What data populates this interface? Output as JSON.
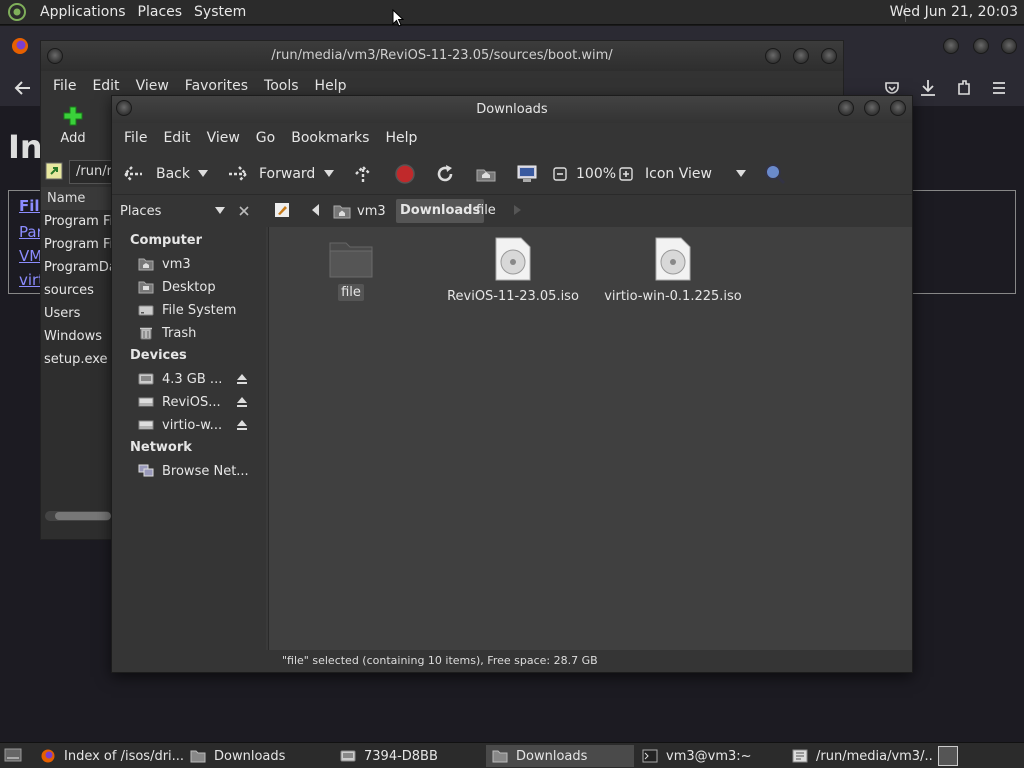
{
  "top_panel": {
    "menus": [
      "Applications",
      "Places",
      "System"
    ],
    "clock": "Wed Jun 21, 20:03"
  },
  "firefox": {
    "heading": "Ind",
    "links": [
      "File",
      "Par",
      "VM",
      "virt"
    ]
  },
  "archive": {
    "title": "/run/media/vm3/ReviOS-11-23.05/sources/boot.wim/",
    "menus": [
      "File",
      "Edit",
      "View",
      "Favorites",
      "Tools",
      "Help"
    ],
    "add_label": "Add",
    "path_value": "/run/r",
    "column_name": "Name",
    "items": [
      "Program Fi",
      "Program Fi",
      "ProgramDa",
      "sources",
      "Users",
      "Windows",
      "setup.exe"
    ]
  },
  "caja": {
    "title": "Downloads",
    "menus": [
      "File",
      "Edit",
      "View",
      "Go",
      "Bookmarks",
      "Help"
    ],
    "toolbar": {
      "back": "Back",
      "forward": "Forward",
      "zoom": "100%",
      "view_mode": "Icon View"
    },
    "sidebar_selector": "Places",
    "path_segments": [
      "vm3",
      "Downloads",
      "file"
    ],
    "sidebar": {
      "computer_header": "Computer",
      "computer_items": [
        "vm3",
        "Desktop",
        "File System",
        "Trash"
      ],
      "devices_header": "Devices",
      "device_items": [
        "4.3 GB ...",
        "ReviOS...",
        "virtio-w..."
      ],
      "network_header": "Network",
      "network_items": [
        "Browse Net..."
      ]
    },
    "files": [
      {
        "name": "file",
        "type": "folder"
      },
      {
        "name": "ReviOS-11-23.05.iso",
        "type": "disc"
      },
      {
        "name": "virtio-win-0.1.225.iso",
        "type": "disc"
      }
    ],
    "status": "\"file\" selected (containing 10 items), Free space: 28.7 GB"
  },
  "taskbar": {
    "items": [
      "Index of /isos/dri...",
      "Downloads",
      "7394-D8BB",
      "Downloads",
      "vm3@vm3:~",
      "/run/media/vm3/..."
    ]
  }
}
